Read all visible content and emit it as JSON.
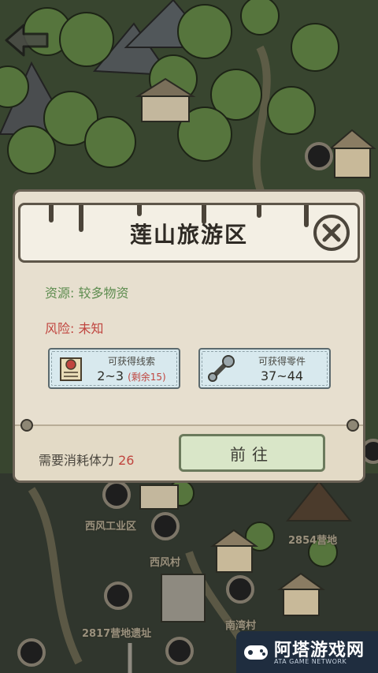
{
  "map": {
    "labels": {
      "west_industrial": "西风工业区",
      "west_village": "西风村",
      "camp_2854": "2854营地",
      "camp_ruins_2817": "2817营地遗址",
      "south_bay_village": "南湾村"
    }
  },
  "dialog": {
    "title": "莲山旅游区",
    "resource_label": "资源:",
    "resource_value": "较多物资",
    "risk_label": "风险:",
    "risk_value": "未知",
    "rewards": [
      {
        "label": "可获得线索",
        "value": "2~3",
        "extra": "(剩余15)",
        "icon": "map-scroll-icon"
      },
      {
        "label": "可获得零件",
        "value": "37~44",
        "extra": "",
        "icon": "wrench-icon"
      }
    ],
    "cost_label": "需要消耗体力",
    "cost_value": "26",
    "go_button": "前往"
  },
  "watermark": {
    "text": "阿塔游戏网",
    "subtext": "ATA GAME NETWORK"
  },
  "colors": {
    "resource_green": "#5d8c4f",
    "risk_red": "#c0453f",
    "dialog_bg": "#e7dfcf"
  }
}
